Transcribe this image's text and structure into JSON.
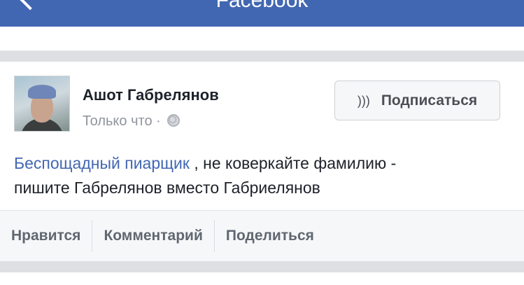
{
  "navbar": {
    "title": "Facebook",
    "back_icon": "chevron-left-icon"
  },
  "post": {
    "author": "Ашот Габрелянов",
    "timestamp": "Только что",
    "meta_separator": "·",
    "privacy_icon": "globe-icon",
    "subscribe_button": {
      "icon": "rss-icon",
      "label": "Подписаться"
    },
    "text": {
      "mention": "Беспощадный пиарщик",
      "line1_rest": ", не коверкайте фамилию -",
      "line2": "пишите Габрелянов вместо Габриелянов"
    },
    "actions": {
      "like": "Нравится",
      "comment": "Комментарий",
      "share": "Поделиться"
    }
  },
  "colors": {
    "brand": "#4267b2",
    "text": "#1d2129",
    "secondary_text": "#90949c",
    "separator": "#dddfe2"
  }
}
